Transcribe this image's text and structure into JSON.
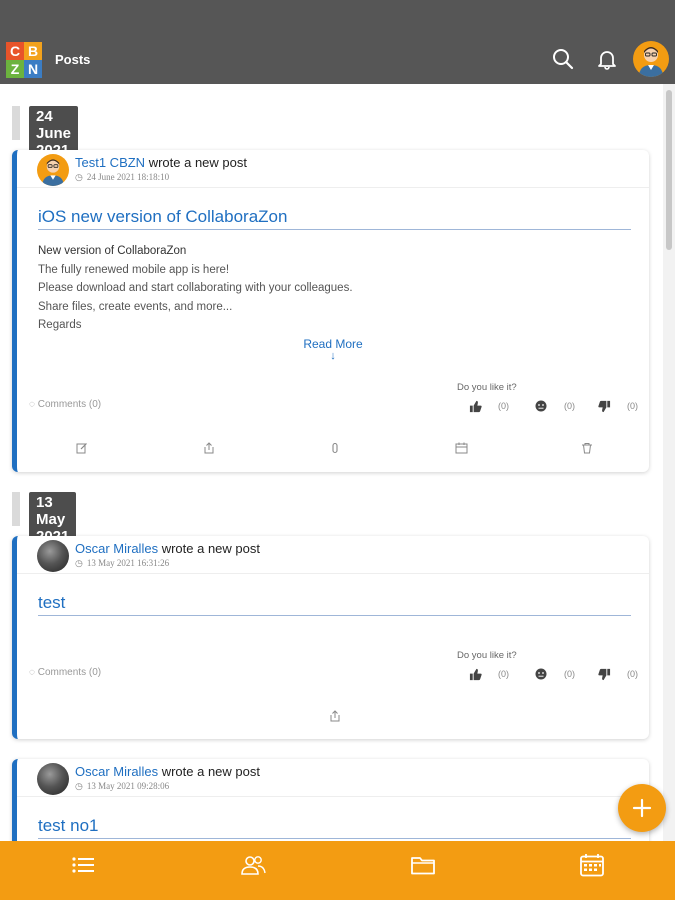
{
  "header": {
    "logo_letters": [
      "C",
      "B",
      "Z",
      "N"
    ],
    "title": "Posts",
    "icons": [
      "search-icon",
      "bell-icon",
      "user-avatar"
    ]
  },
  "posts": [
    {
      "date": "24 June 2021",
      "author": "Test1 CBZN",
      "action": "wrote a new post",
      "timestamp": "24 June 2021 18:18:10",
      "title": "iOS new version of CollaboraZon",
      "body": [
        "New version of CollaboraZon",
        "The fully renewed mobile app is here!",
        "Please download and start collaborating with your colleagues.",
        "Share files, create events, and more...",
        "Regards"
      ],
      "read_more": "Read More",
      "comments": "Comments (0)",
      "like_question": "Do you like it?",
      "likes": "(0)",
      "neutral": "(0)",
      "dislikes": "(0)",
      "actions": [
        "edit-icon",
        "share-icon",
        "attachment-icon",
        "calendar-icon",
        "delete-icon"
      ]
    },
    {
      "date": "13 May 2021",
      "author": "Oscar Miralles",
      "action": "wrote a new post",
      "timestamp": "13 May 2021 16:31:26",
      "title": "test",
      "comments": "Comments (0)",
      "like_question": "Do you like it?",
      "likes": "(0)",
      "neutral": "(0)",
      "dislikes": "(0)",
      "actions": [
        "share-icon"
      ]
    },
    {
      "author": "Oscar Miralles",
      "action": "wrote a new post",
      "timestamp": "13 May 2021 09:28:06",
      "title": "test no1"
    }
  ],
  "fab": {
    "icon": "plus-icon"
  },
  "bottom_nav": [
    "list-icon",
    "users-icon",
    "folder-icon",
    "calendar-icon"
  ],
  "colors": {
    "topbar": "#565656",
    "accent": "#f39c12",
    "link": "#1f6fc1",
    "date_badge": "#4d4d4d"
  }
}
